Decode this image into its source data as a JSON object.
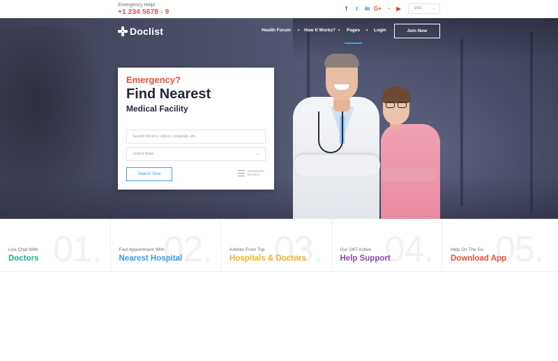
{
  "topbar": {
    "emergency_label": "Emergency Help!",
    "emergency_phone": "+1 234 5678 - 9",
    "socials": [
      {
        "icon": "facebook-icon",
        "glyph": "f",
        "color": "#3b5998"
      },
      {
        "icon": "twitter-icon",
        "glyph": "t",
        "color": "#1da1f2"
      },
      {
        "icon": "linkedin-icon",
        "glyph": "in",
        "color": "#0077b5"
      },
      {
        "icon": "google-plus-icon",
        "glyph": "G+",
        "color": "#dd4b39"
      },
      {
        "icon": "rss-icon",
        "glyph": "◔",
        "color": "#f26522"
      },
      {
        "icon": "youtube-icon",
        "glyph": "▶",
        "color": "#e52d27"
      }
    ],
    "language": "ENG"
  },
  "header": {
    "logo_text": "Doclist",
    "nav": [
      "Health Forum",
      "How It Works?",
      "Pages",
      "Login"
    ],
    "active_nav": "Pages",
    "join_label": "Join Now"
  },
  "search_card": {
    "eyebrow": "Emergency?",
    "headline": "Find Nearest",
    "subheadline": "Medical Facility",
    "search_placeholder": "Search doctors, clinics, hospitals, etc.",
    "location_value": "United State",
    "search_button": "Search Now",
    "advanced_line1": "ADVANCED",
    "advanced_line2": "SEARCH"
  },
  "features": [
    {
      "number": "01.",
      "sub": "Live Chat With",
      "title": "Doctors",
      "color": "#1bb38f"
    },
    {
      "number": "02.",
      "sub": "Fast Appointment With",
      "title": "Nearest Hospital",
      "color": "#3a9ce6"
    },
    {
      "number": "03.",
      "sub": "Articles From Top",
      "title": "Hospitals & Doctors",
      "color": "#f1b21c"
    },
    {
      "number": "04.",
      "sub": "Our 24/7 Active",
      "title": "Help Support",
      "color": "#8e44ad"
    },
    {
      "number": "05.",
      "sub": "Help On The Go",
      "title": "Download App",
      "color": "#ef4d3c"
    }
  ],
  "colors": {
    "accent": "#3aa3e3",
    "emergency": "#ef4d3c",
    "heading": "#24283a"
  }
}
